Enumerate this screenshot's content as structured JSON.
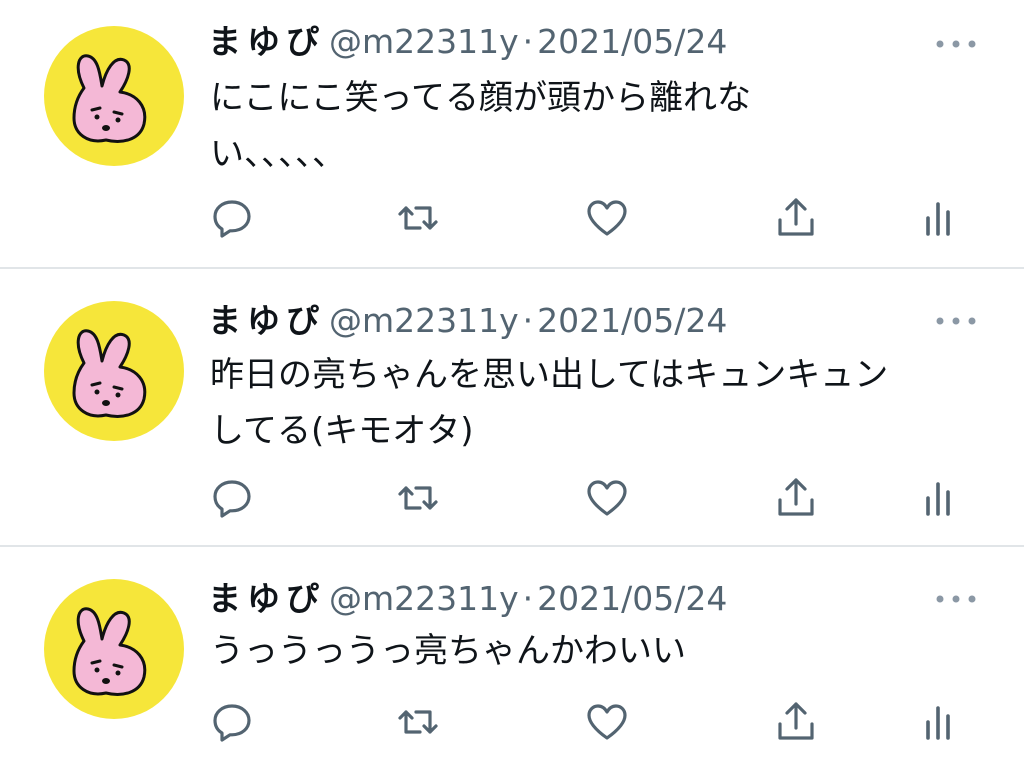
{
  "tweets": [
    {
      "name": "まゆぴ",
      "handle": "@m22311y",
      "separator": "·",
      "date": "2021/05/24",
      "text": "にこにこ笑ってる顔が頭から離れな\nい、、、、、"
    },
    {
      "name": "まゆぴ",
      "handle": "@m22311y",
      "separator": "·",
      "date": "2021/05/24",
      "text": "昨日の亮ちゃんを思い出してはキュンキュン\nしてる(キモオタ)"
    },
    {
      "name": "まゆぴ",
      "handle": "@m22311y",
      "separator": "·",
      "date": "2021/05/24",
      "text": "うっうっうっ亮ちゃんかわいい"
    }
  ],
  "icons": {
    "avatar": "pink-rabbit-avatar",
    "more": "more-dots-icon",
    "actions": [
      "reply-icon",
      "retweet-icon",
      "like-icon",
      "share-icon",
      "analytics-icon"
    ]
  },
  "colors": {
    "text": "#0f1419",
    "secondary": "#536471",
    "icon": "#536471",
    "avatar_bg": "#f6e63a",
    "rabbit": "#f4b8d6",
    "divider": "#e1e5e8"
  }
}
